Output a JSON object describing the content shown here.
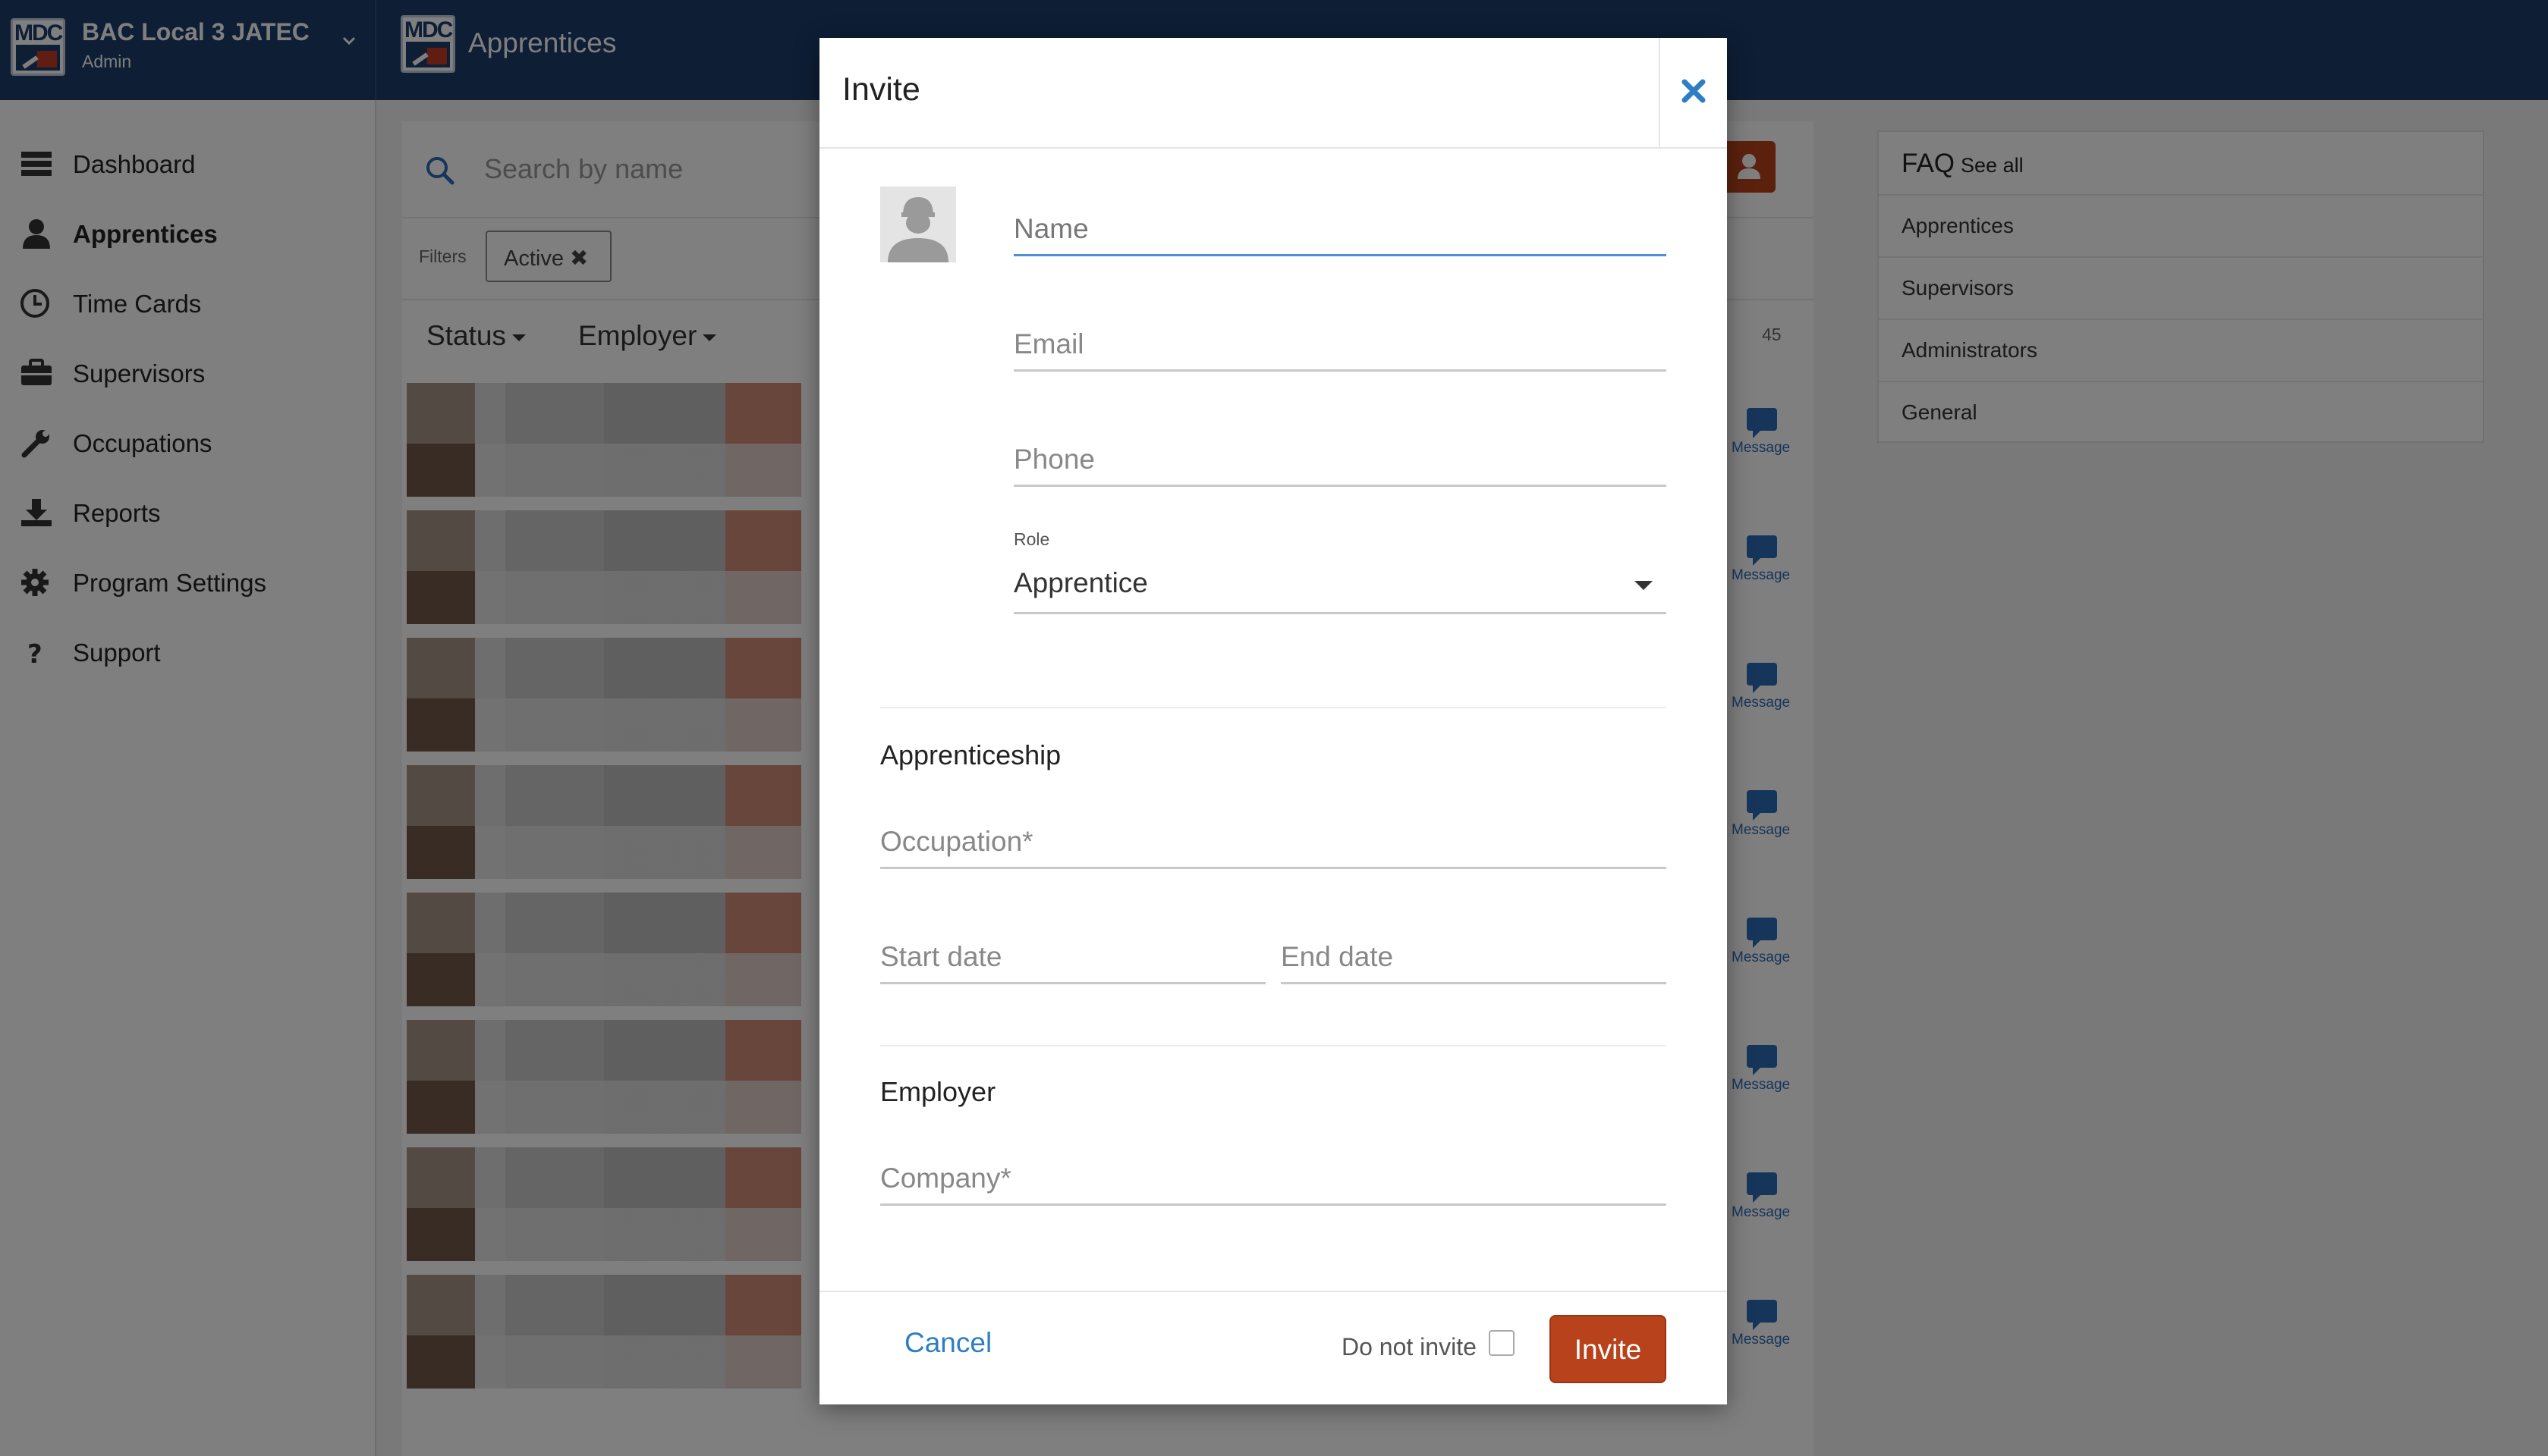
{
  "app": {
    "brand": {
      "name": "BAC Local 3 JATEC",
      "role": "Admin",
      "logo_text": "MDC"
    },
    "page_title": "Apprentices"
  },
  "sidebar": {
    "items": [
      {
        "label": "Dashboard",
        "icon": "dashboard-icon",
        "active": false
      },
      {
        "label": "Apprentices",
        "icon": "user-icon",
        "active": true
      },
      {
        "label": "Time Cards",
        "icon": "clock-icon",
        "active": false
      },
      {
        "label": "Supervisors",
        "icon": "briefcase-icon",
        "active": false
      },
      {
        "label": "Occupations",
        "icon": "wrench-icon",
        "active": false
      },
      {
        "label": "Reports",
        "icon": "download-icon",
        "active": false
      },
      {
        "label": "Program Settings",
        "icon": "gear-icon",
        "active": false
      },
      {
        "label": "Support",
        "icon": "question-icon",
        "active": false
      }
    ]
  },
  "list": {
    "search_placeholder": "Search by name",
    "filters_label": "Filters",
    "active_filter": "Active ✖",
    "columns": {
      "status": "Status",
      "employer": "Employer"
    },
    "count": "45",
    "message_label": "Message"
  },
  "faq": {
    "title": "FAQ",
    "see_all": "See all",
    "items": [
      "Apprentices",
      "Supervisors",
      "Administrators",
      "General"
    ]
  },
  "modal": {
    "title": "Invite",
    "fields": {
      "name_placeholder": "Name",
      "email_placeholder": "Email",
      "phone_placeholder": "Phone",
      "role_label": "Role",
      "role_value": "Apprentice",
      "occupation_placeholder": "Occupation*",
      "start_date_placeholder": "Start date",
      "end_date_placeholder": "End date",
      "company_placeholder": "Company*"
    },
    "sections": {
      "apprenticeship": "Apprenticeship",
      "employer": "Employer"
    },
    "footer": {
      "cancel": "Cancel",
      "do_not_invite": "Do not invite",
      "invite": "Invite"
    }
  },
  "colors": {
    "header": "#1a3d6b",
    "accent": "#b8421b",
    "link": "#2d7ec4",
    "focus": "#4a90d9"
  }
}
